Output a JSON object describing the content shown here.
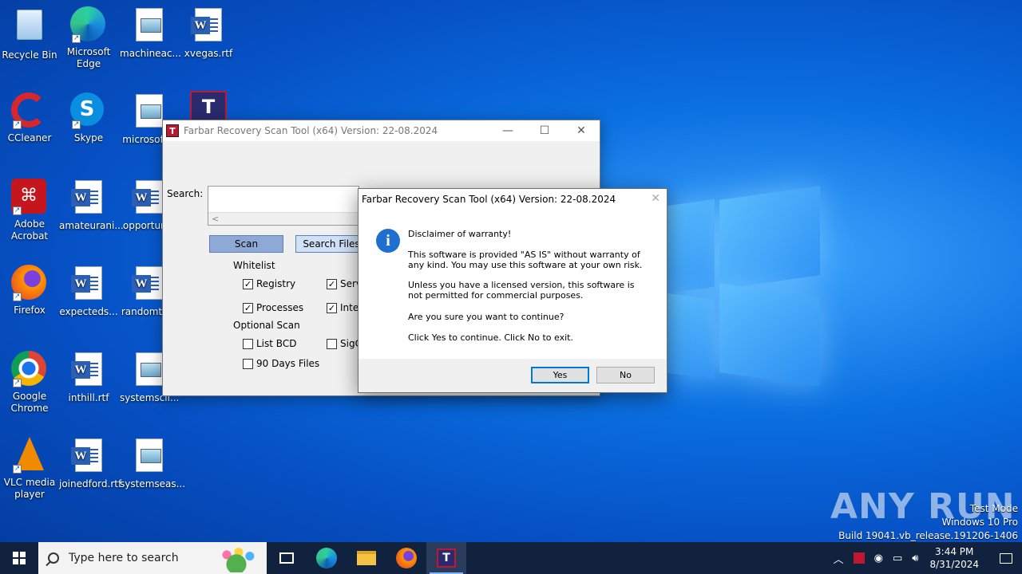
{
  "desktop_icons": [
    {
      "label": "Recycle Bin"
    },
    {
      "label": "Microsoft Edge"
    },
    {
      "label": "machineac..."
    },
    {
      "label": "xvegas.rtf"
    },
    {
      "label": "CCleaner"
    },
    {
      "label": "Skype"
    },
    {
      "label": "microsoft..."
    },
    {
      "label": "Adobe Acrobat"
    },
    {
      "label": "amateurani..."
    },
    {
      "label": "opportun..."
    },
    {
      "label": "Firefox"
    },
    {
      "label": "expecteds..."
    },
    {
      "label": "randomth..."
    },
    {
      "label": "Google Chrome"
    },
    {
      "label": "inthill.rtf"
    },
    {
      "label": "systemscli..."
    },
    {
      "label": "VLC media player"
    },
    {
      "label": "joinedford.rtf"
    },
    {
      "label": "systemseas..."
    }
  ],
  "main_window": {
    "title": "Farbar Recovery Scan Tool (x64) Version: 22-08.2024",
    "search_label": "Search:",
    "scroll_left": "<",
    "scan_button": "Scan",
    "search_files_button": "Search Files",
    "whitelist_label": "Whitelist",
    "whitelist": [
      {
        "label": "Registry",
        "checked": true
      },
      {
        "label": "Services",
        "checked": true
      },
      {
        "label": "Processes",
        "checked": true
      },
      {
        "label": "Internet",
        "checked": true
      }
    ],
    "optional_scan_label": "Optional Scan",
    "optional": [
      {
        "label": "List BCD",
        "checked": false
      },
      {
        "label": "SigCheck",
        "checked": false
      },
      {
        "label": "90 Days Files",
        "checked": false
      }
    ]
  },
  "dialog": {
    "title": "Farbar Recovery Scan Tool (x64) Version: 22-08.2024",
    "heading": "Disclaimer of warranty!",
    "para1": "This software is provided \"AS IS\" without warranty of any kind. You may use this software at your own risk.",
    "para2": "Unless you have a licensed version, this software is not permitted for commercial purposes.",
    "question": "Are you sure you want to continue?",
    "instruction": "Click Yes to continue. Click No to exit.",
    "yes": "Yes",
    "no": "No"
  },
  "watermark": {
    "brand": "ANY RUN",
    "line1": "Test Mode",
    "line2": "Windows 10 Pro",
    "line3": "Build 19041.vb_release.191206-1406"
  },
  "taskbar": {
    "search_placeholder": "Type here to search",
    "time": "3:44 PM",
    "date": "8/31/2024"
  }
}
